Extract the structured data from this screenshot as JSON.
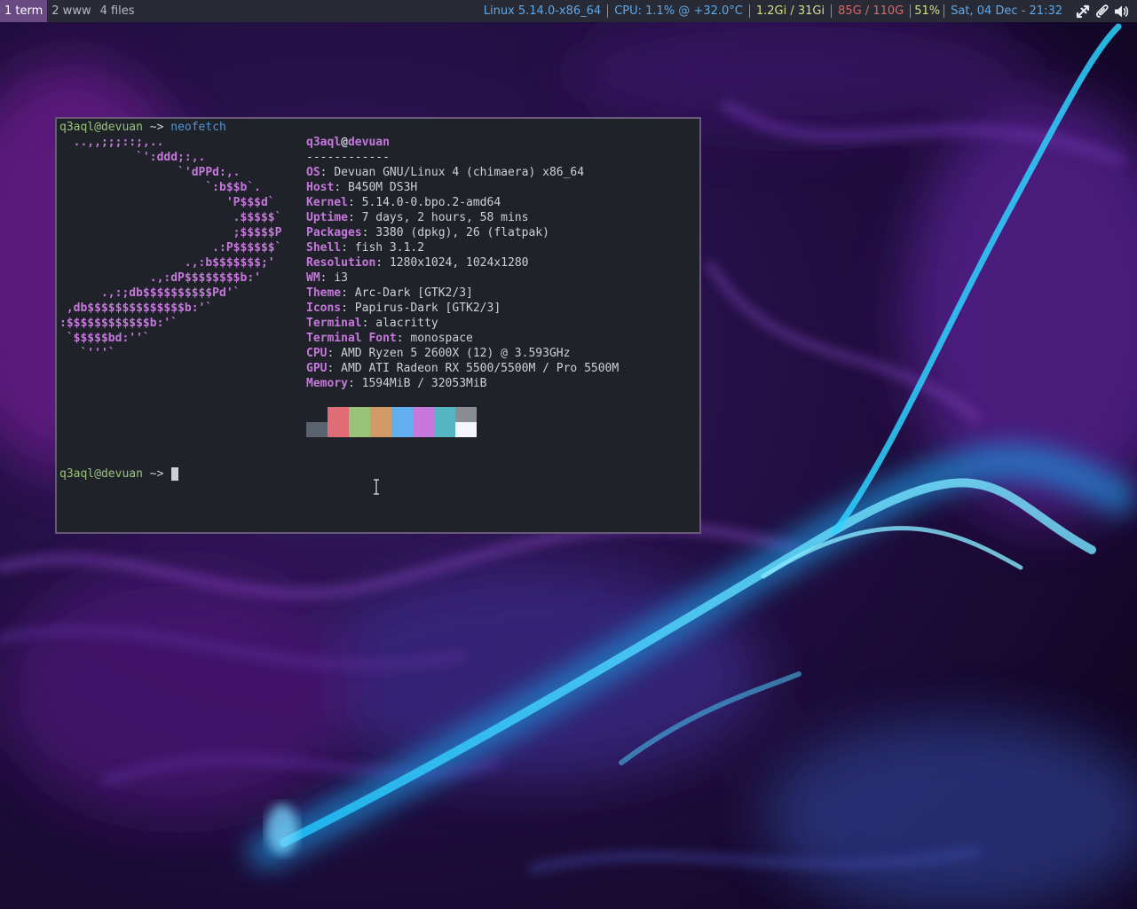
{
  "topbar": {
    "workspaces": [
      "1 term",
      "2 www",
      "4 files"
    ],
    "status": {
      "kernel": "Linux 5.14.0-x86_64",
      "cpu": "CPU: 1.1% @ +32.0°C",
      "mem": "1.2Gi / 31Gi",
      "disk": "85G / 110G",
      "volume": "51%",
      "datetime": "Sat, 04 Dec - 21:32"
    },
    "colors": {
      "kernel": "#5fa8e8",
      "cpu": "#5fa8e8",
      "mem": "#d7dc8a",
      "disk": "#d46a6a",
      "volume": "#d7dc8a",
      "datetime": "#5fa8e8"
    },
    "tray_icons": [
      "network-icon",
      "paperclip-icon",
      "volume-icon"
    ]
  },
  "terminal": {
    "prompt_user_host": "q3aql@devuan",
    "prompt_symbol": " ~> ",
    "command": "neofetch",
    "ascii_art": [
      "  ..,,;;;::;,..",
      "           `':ddd;:,.",
      "                 `'dPPd:,.",
      "                     `:b$$b`.",
      "                        'P$$$d`",
      "                         .$$$$$`",
      "                         ;$$$$$P",
      "                      .:P$$$$$$`",
      "                  .,:b$$$$$$$;'",
      "             .,:dP$$$$$$$$b:'",
      "      .,:;db$$$$$$$$$$Pd'`",
      " ,db$$$$$$$$$$$$$$b:'`",
      ":$$$$$$$$$$$$b:'`",
      " `$$$$$bd:''`",
      "   `'''`"
    ],
    "title_user": "q3aql",
    "title_at": "@",
    "title_host": "devuan",
    "separator": "------------",
    "info": [
      {
        "key": "OS",
        "value": "Devuan GNU/Linux 4 (chimaera) x86_64"
      },
      {
        "key": "Host",
        "value": "B450M DS3H"
      },
      {
        "key": "Kernel",
        "value": "5.14.0-0.bpo.2-amd64"
      },
      {
        "key": "Uptime",
        "value": "7 days, 2 hours, 58 mins"
      },
      {
        "key": "Packages",
        "value": "3380 (dpkg), 26 (flatpak)"
      },
      {
        "key": "Shell",
        "value": "fish 3.1.2"
      },
      {
        "key": "Resolution",
        "value": "1280x1024, 1024x1280"
      },
      {
        "key": "WM",
        "value": "i3"
      },
      {
        "key": "Theme",
        "value": "Arc-Dark [GTK2/3]"
      },
      {
        "key": "Icons",
        "value": "Papirus-Dark [GTK2/3]"
      },
      {
        "key": "Terminal",
        "value": "alacritty"
      },
      {
        "key": "Terminal Font",
        "value": "monospace"
      },
      {
        "key": "CPU",
        "value": "AMD Ryzen 5 2600X (12) @ 3.593GHz"
      },
      {
        "key": "GPU",
        "value": "AMD ATI Radeon RX 5500/5500M / Pro 5500M"
      },
      {
        "key": "Memory",
        "value": "1594MiB / 32053MiB"
      }
    ],
    "palette_top": [
      "#1f2329",
      "#e06c75",
      "#98c379",
      "#d19a66",
      "#61afef",
      "#c678dd",
      "#56b6c2",
      "#8b8d93"
    ],
    "palette_bottom": [
      "#5c6370",
      "#e06c75",
      "#98c379",
      "#d19a66",
      "#61afef",
      "#c678dd",
      "#56b6c2",
      "#f3f6ff"
    ]
  }
}
